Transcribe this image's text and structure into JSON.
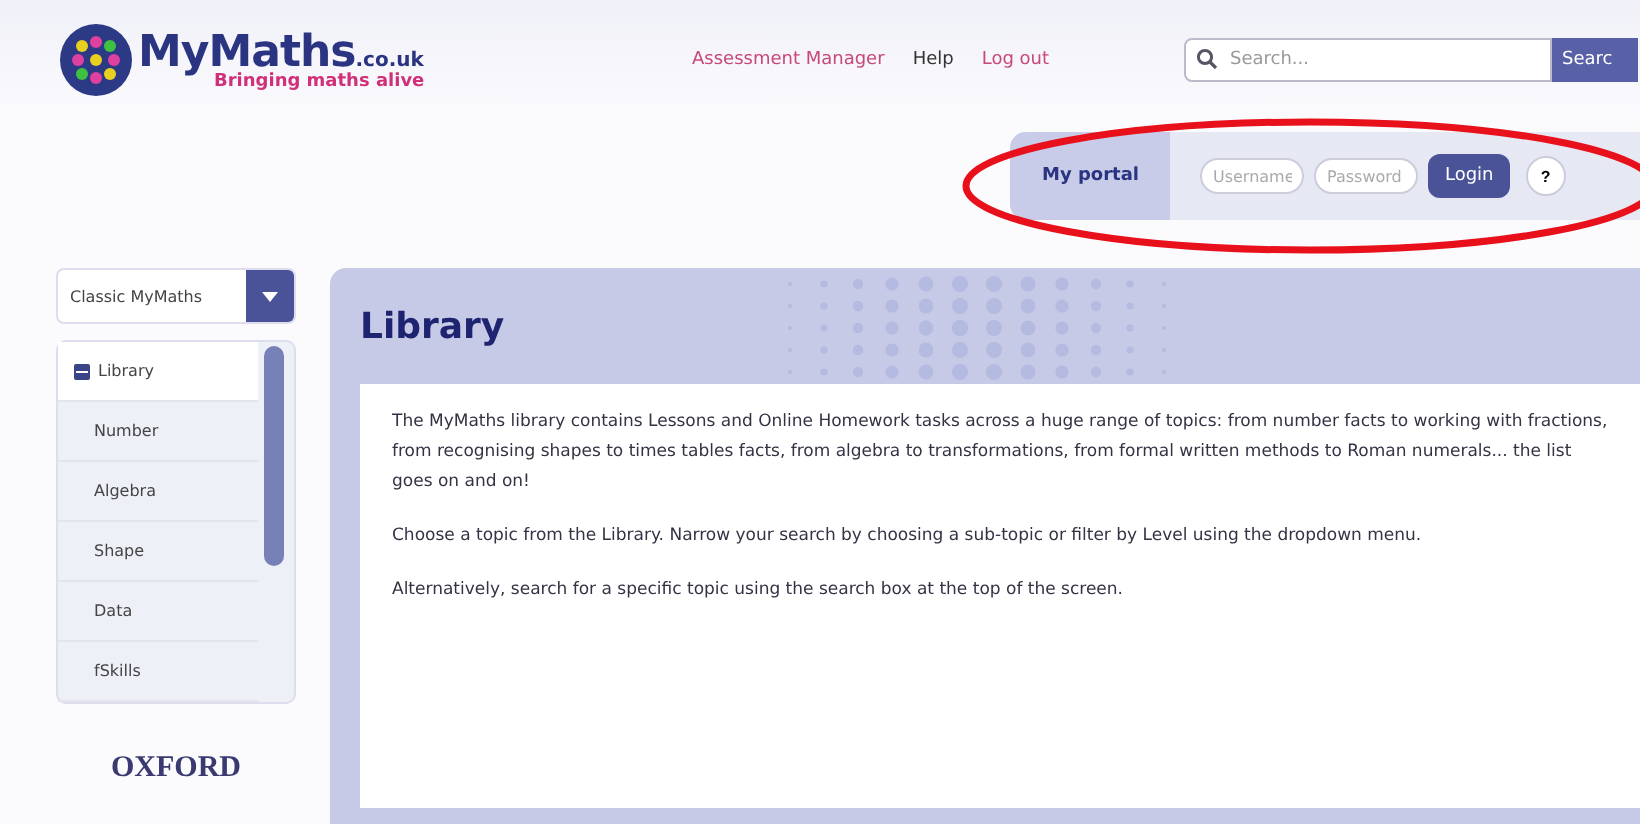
{
  "header": {
    "logo": {
      "name": "MyMaths",
      "domain": ".co.uk",
      "tagline": "Bringing maths alive"
    },
    "nav": [
      {
        "label": "Assessment Manager",
        "kind": "accent"
      },
      {
        "label": "Help",
        "kind": "plain"
      },
      {
        "label": "Log out",
        "kind": "accent"
      }
    ],
    "search": {
      "placeholder": "Search...",
      "button": "Searc"
    }
  },
  "portal": {
    "tab": "My portal",
    "username_placeholder": "Username",
    "password_placeholder": "Password",
    "login": "Login",
    "help": "?"
  },
  "sidebar": {
    "dropdown": "Classic MyMaths",
    "items": [
      {
        "label": "Library",
        "kind": "heading",
        "selected": true
      },
      {
        "label": "Number",
        "kind": "topic",
        "selected": false
      },
      {
        "label": "Algebra",
        "kind": "topic",
        "selected": false
      },
      {
        "label": "Shape",
        "kind": "topic",
        "selected": false
      },
      {
        "label": "Data",
        "kind": "topic",
        "selected": false
      },
      {
        "label": "fSkills",
        "kind": "topic",
        "selected": false
      }
    ],
    "publisher": "OXFORD"
  },
  "main": {
    "title": "Library",
    "paragraphs": [
      "The MyMaths library contains Lessons and Online Homework tasks across a huge range of topics: from number facts to working with fractions, from recognising shapes to times tables facts, from algebra to transformations, from formal written methods to Roman numerals... the list goes on and on!",
      "Choose a topic from the Library. Narrow your search by choosing a sub-topic or filter by Level using the dropdown menu.",
      "Alternatively, search for a specific topic using the search box at the top of the screen."
    ]
  }
}
